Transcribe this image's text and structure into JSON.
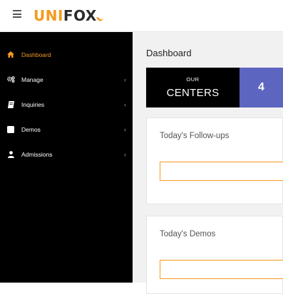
{
  "brand": {
    "part1": "UNI",
    "part2": "FOX",
    "accent": "#f39a1e"
  },
  "sidebar": {
    "items": [
      {
        "label": "Dashboard",
        "icon": "home-icon",
        "active": true
      },
      {
        "label": "Manage",
        "icon": "gears-icon",
        "active": false
      },
      {
        "label": "Inquiries",
        "icon": "book-icon",
        "active": false
      },
      {
        "label": "Demos",
        "icon": "square-icon",
        "active": false
      },
      {
        "label": "Admissions",
        "icon": "user-icon",
        "active": false
      }
    ],
    "chevron": "‹"
  },
  "main": {
    "page_title": "Dashboard",
    "stat": {
      "small": "OUR",
      "big": "CENTERS",
      "value": "4",
      "color": "#5c65c0"
    },
    "cards": [
      {
        "title": "Today's Follow-ups"
      },
      {
        "title": "Today's Demos"
      }
    ]
  }
}
